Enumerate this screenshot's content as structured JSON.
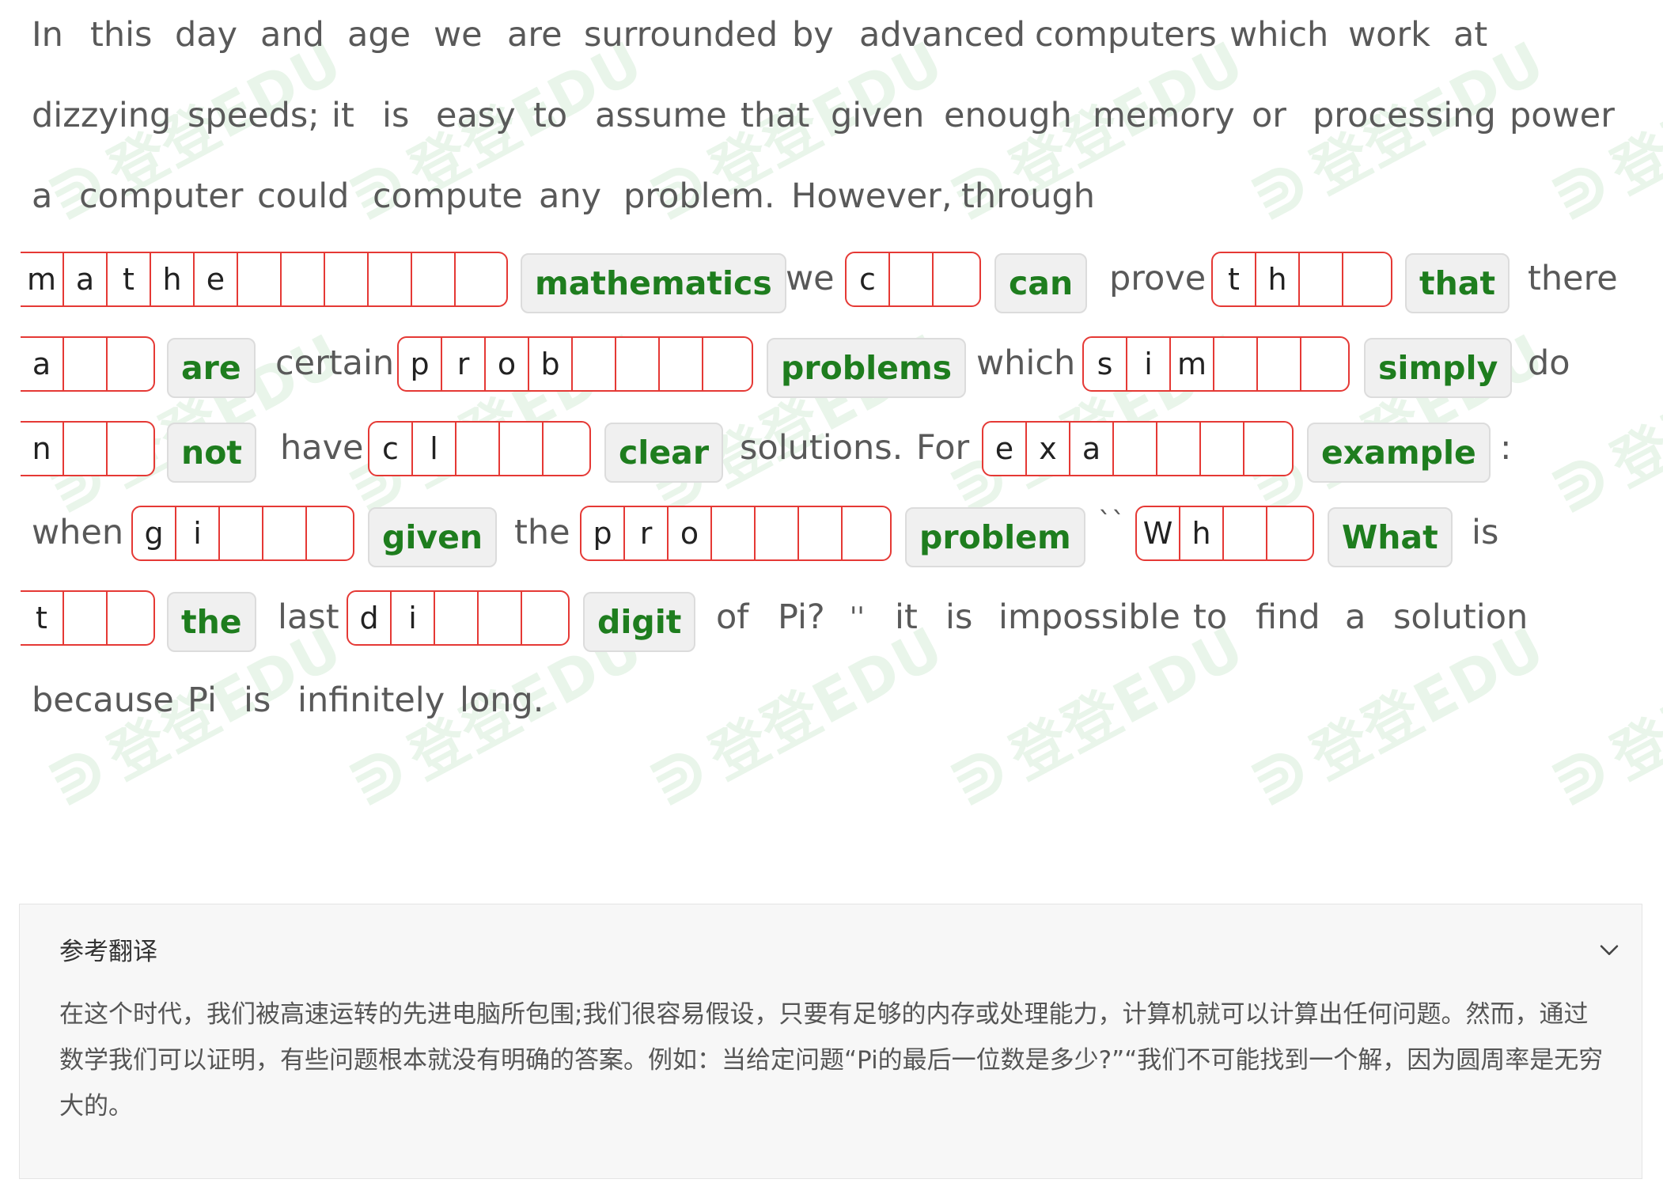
{
  "watermark": {
    "text": "登登EDU",
    "icon": "brand-logo-icon"
  },
  "passage": {
    "lines": [
      {
        "words": [
          "In",
          "this",
          "day",
          "and",
          "age",
          "we",
          "are",
          "surrounded",
          "by",
          "advanced",
          "computers",
          "which",
          "work",
          "at"
        ]
      },
      {
        "words": [
          "dizzying",
          "speeds;",
          "it",
          "is",
          "easy",
          "to",
          "assume",
          "that",
          "given",
          "enough",
          "memory",
          "or",
          "processing",
          "power"
        ]
      },
      {
        "words": [
          "a",
          "computer",
          "could",
          "compute",
          "any",
          "problem.",
          "However,",
          "through"
        ]
      },
      {
        "words": [
          "we",
          "prove",
          "there"
        ],
        "blanks": [
          {
            "cells": [
              "m",
              "a",
              "t",
              "h",
              "e",
              "",
              "",
              "",
              "",
              "",
              ""
            ],
            "answer": "mathematics"
          },
          {
            "cells": [
              "c",
              "",
              ""
            ],
            "answer": "can"
          },
          {
            "cells": [
              "t",
              "h",
              "",
              ""
            ],
            "answer": "that"
          }
        ]
      },
      {
        "words": [
          "certain",
          "which",
          "do"
        ],
        "blanks": [
          {
            "cells": [
              "a",
              "",
              ""
            ],
            "answer": "are"
          },
          {
            "cells": [
              "p",
              "r",
              "o",
              "b",
              "",
              "",
              "",
              ""
            ],
            "answer": "problems"
          },
          {
            "cells": [
              "s",
              "i",
              "m",
              "",
              "",
              ""
            ],
            "answer": "simply"
          }
        ]
      },
      {
        "words": [
          "have",
          "solutions.",
          "For",
          ":"
        ],
        "blanks": [
          {
            "cells": [
              "n",
              "",
              ""
            ],
            "answer": "not"
          },
          {
            "cells": [
              "c",
              "l",
              "",
              "",
              ""
            ],
            "answer": "clear"
          },
          {
            "cells": [
              "e",
              "x",
              "a",
              "",
              "",
              "",
              ""
            ],
            "answer": "example"
          }
        ]
      },
      {
        "words": [
          "when",
          "the",
          "``",
          "is"
        ],
        "blanks": [
          {
            "cells": [
              "g",
              "i",
              "",
              "",
              ""
            ],
            "answer": "given"
          },
          {
            "cells": [
              "p",
              "r",
              "o",
              "",
              "",
              "",
              ""
            ],
            "answer": "problem"
          },
          {
            "cells": [
              "W",
              "h",
              "",
              ""
            ],
            "answer": "What"
          }
        ]
      },
      {
        "words": [
          "last",
          "of",
          "Pi?",
          "''",
          "it",
          "is",
          "impossible",
          "to",
          "find",
          "a",
          "solution"
        ],
        "blanks": [
          {
            "cells": [
              "t",
              "",
              ""
            ],
            "answer": "the"
          },
          {
            "cells": [
              "d",
              "i",
              "",
              "",
              ""
            ],
            "answer": "digit"
          }
        ]
      },
      {
        "words": [
          "because",
          "Pi",
          "is",
          "infinitely",
          "long."
        ]
      }
    ]
  },
  "translation": {
    "title": "参考翻译",
    "toggle_icon": "chevron-down-icon",
    "text": "在这个时代，我们被高速运转的先进电脑所包围;我们很容易假设，只要有足够的内存或处理能力，计算机就可以计算出任何问题。然而，通过数学我们可以证明，有些问题根本就没有明确的答案。例如：当给定问题“Pi的最后一位数是多少?”“我们不可能找到一个解，因为圆周率是无穷大的。"
  },
  "colors": {
    "answer_green": "#1e7d1e",
    "blank_red": "#e53935",
    "text_gray": "#595959"
  }
}
